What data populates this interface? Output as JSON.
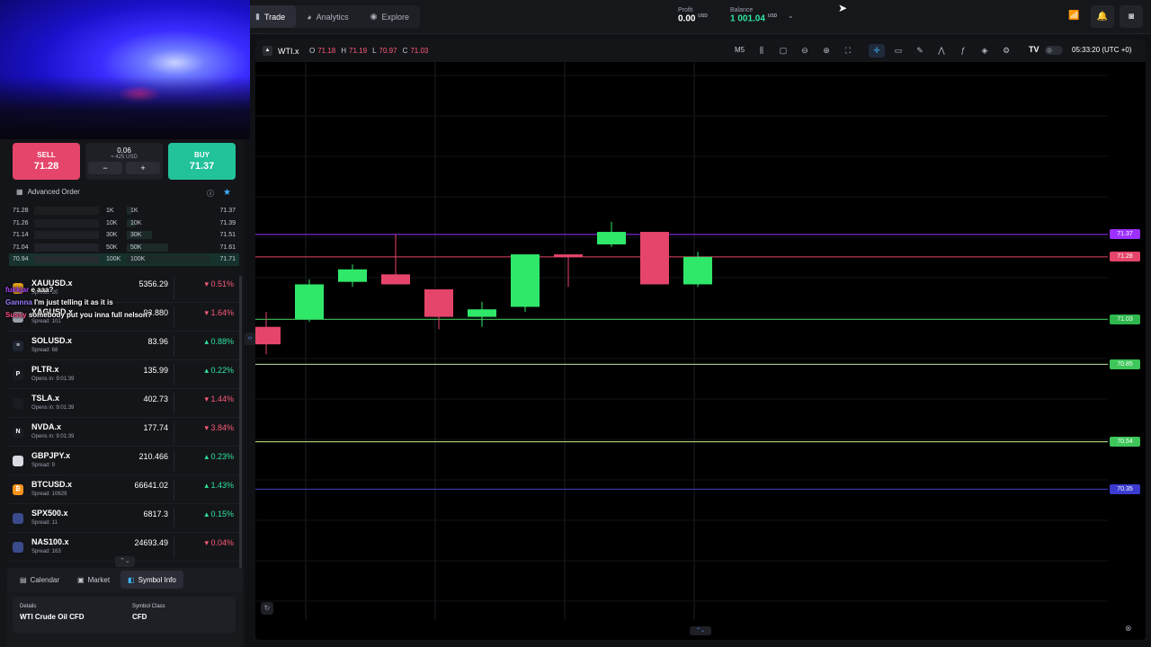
{
  "header": {
    "nav": [
      {
        "label": "Trade",
        "icon": "trade-icon"
      },
      {
        "label": "Analytics",
        "icon": "analytics-icon"
      },
      {
        "label": "Explore",
        "icon": "explore-icon"
      }
    ],
    "profit_label": "Profit",
    "profit_value": "0.00",
    "profit_unit": "USD",
    "balance_label": "Balance",
    "balance_value": "1 001.04",
    "balance_unit": "USD"
  },
  "trade": {
    "sell_label": "SELL",
    "sell_price": "71.28",
    "buy_label": "BUY",
    "buy_price": "71.37",
    "quantity": "0.06",
    "quantity_usd": "≈ 425 USD",
    "minus": "−",
    "plus": "+",
    "advanced_order": "Advanced Order"
  },
  "depth": [
    {
      "bid": "71.28",
      "bid_qty": "1K",
      "ask_qty": "1K",
      "ask": "71.37",
      "fill": 0.05
    },
    {
      "bid": "71.26",
      "bid_qty": "10K",
      "ask_qty": "10K",
      "ask": "71.39",
      "fill": 0.1
    },
    {
      "bid": "71.14",
      "bid_qty": "30K",
      "ask_qty": "30K",
      "ask": "71.51",
      "fill": 0.3
    },
    {
      "bid": "71.04",
      "bid_qty": "50K",
      "ask_qty": "50K",
      "ask": "71.61",
      "fill": 0.5
    },
    {
      "bid": "70.94",
      "bid_qty": "100K",
      "ask_qty": "100K",
      "ask": "71.71",
      "fill": 1.0
    }
  ],
  "watchlist": [
    {
      "symbol": "XAUUSD.x",
      "sub": "Spread: 20",
      "price": "5356.29",
      "change": "0.51%",
      "dir": "down",
      "icon_color": "#e2a21a",
      "icon": "gold-icon"
    },
    {
      "symbol": "XAGUSD.x",
      "sub": "Spread: 101",
      "price": "93.880",
      "change": "1.64%",
      "dir": "down",
      "icon_color": "#9aa0ab",
      "icon": "silver-icon"
    },
    {
      "symbol": "SOLUSD.x",
      "sub": "Spread: 68",
      "price": "83.96",
      "change": "0.88%",
      "dir": "up",
      "icon_color": "#1e2430",
      "icon": "solana-icon"
    },
    {
      "symbol": "PLTR.x",
      "sub": "Opens in: 9:01:39",
      "price": "135.99",
      "change": "0.22%",
      "dir": "up",
      "icon_color": "#1a1c21",
      "icon": "palantir-icon"
    },
    {
      "symbol": "TSLA.x",
      "sub": "Opens in: 9:01:39",
      "price": "402.73",
      "change": "1.44%",
      "dir": "down",
      "icon_color": "#1a1c21",
      "icon": "tesla-icon"
    },
    {
      "symbol": "NVDA.x",
      "sub": "Opens in: 9:01:39",
      "price": "177.74",
      "change": "3.84%",
      "dir": "down",
      "icon_color": "#1a1c21",
      "icon": "nvidia-icon"
    },
    {
      "symbol": "GBPJPY.x",
      "sub": "Spread: 9",
      "price": "210.466",
      "change": "0.23%",
      "dir": "up",
      "icon_color": "#d8dbe2",
      "icon": "gbp-jpy-flag-icon"
    },
    {
      "symbol": "BTCUSD.x",
      "sub": "Spread: 10629",
      "price": "66641.02",
      "change": "1.43%",
      "dir": "up",
      "icon_color": "#f7931a",
      "icon": "bitcoin-icon"
    },
    {
      "symbol": "SPX500.x",
      "sub": "Spread: 11",
      "price": "6817.3",
      "change": "0.15%",
      "dir": "up",
      "icon_color": "#3a4a8a",
      "icon": "us-flag-icon"
    },
    {
      "symbol": "NAS100.x",
      "sub": "Spread: 163",
      "price": "24693.49",
      "change": "0.04%",
      "dir": "down",
      "icon_color": "#3a4a8a",
      "icon": "us-flag-icon"
    }
  ],
  "watchlist_icon_letters": [
    "",
    "",
    "≡",
    "P",
    "",
    "N",
    "",
    "₿",
    "",
    ""
  ],
  "chat": [
    {
      "name": "fukkjar",
      "name_color": "#b043ff",
      "msg": "e aaa?"
    },
    {
      "name": "Gannna",
      "name_color": "#9b7bff",
      "msg": "I'm just telling it as it is"
    },
    {
      "name": "Sussy",
      "name_color": "#ff4f8a",
      "msg": "somebody put you inna full nelson?"
    }
  ],
  "bottom_tabs": [
    {
      "label": "Calendar",
      "icon": "calendar-icon"
    },
    {
      "label": "Market",
      "icon": "market-icon"
    },
    {
      "label": "Symbol Info",
      "icon": "symbol-info-icon"
    }
  ],
  "symbol_info": {
    "details_label": "Details",
    "details_value": "WTI Crude Oil CFD",
    "class_label": "Symbol Class",
    "class_value": "CFD"
  },
  "chart": {
    "symbol": "WTI.x",
    "open_label": "O",
    "open": "71.18",
    "high_label": "H",
    "high": "71.19",
    "low_label": "L",
    "low": "70.97",
    "close_label": "C",
    "close": "71.03",
    "timeframe": "M5",
    "time": "05:33:20 (UTC +0)"
  },
  "chart_data": {
    "type": "candlestick",
    "ylim": [
      69.83,
      72.06
    ],
    "candles": [
      {
        "o": 71.0,
        "h": 71.06,
        "l": 70.89,
        "c": 70.93
      },
      {
        "o": 71.03,
        "h": 71.19,
        "l": 71.02,
        "c": 71.17
      },
      {
        "o": 71.18,
        "h": 71.25,
        "l": 71.16,
        "c": 71.23
      },
      {
        "o": 71.21,
        "h": 71.37,
        "l": 71.17,
        "c": 71.17
      },
      {
        "o": 71.15,
        "h": 71.15,
        "l": 70.99,
        "c": 71.04
      },
      {
        "o": 71.04,
        "h": 71.1,
        "l": 71.0,
        "c": 71.07
      },
      {
        "o": 71.08,
        "h": 71.29,
        "l": 71.06,
        "c": 71.29
      },
      {
        "o": 71.29,
        "h": 71.29,
        "l": 71.16,
        "c": 71.28
      },
      {
        "o": 71.33,
        "h": 71.42,
        "l": 71.32,
        "c": 71.38
      },
      {
        "o": 71.38,
        "h": 71.38,
        "l": 71.17,
        "c": 71.17
      },
      {
        "o": 71.17,
        "h": 71.3,
        "l": 71.16,
        "c": 71.28
      }
    ],
    "price_lines": [
      {
        "price": 71.37,
        "color": "#9b30ff",
        "label": "71.37",
        "tag_bg": "#9b30ff"
      },
      {
        "price": 71.28,
        "color": "#e5456a",
        "label": "71.28",
        "tag_bg": "#e5456a"
      },
      {
        "price": 71.03,
        "color": "#3ec65a",
        "label": "71.03",
        "tag_bg": "#2fb84e"
      },
      {
        "price": 70.85,
        "color": "#bfe8a0",
        "label": "70.85",
        "tag_bg": "#3ec65a"
      },
      {
        "price": 70.54,
        "color": "#c6ef8a",
        "label": "70.54",
        "tag_bg": "#3ec65a"
      },
      {
        "price": 70.35,
        "color": "#4040c0",
        "label": "70.35",
        "tag_bg": "#3b3bd0"
      }
    ],
    "colors": {
      "up": "#2fe86a",
      "down": "#e5456a",
      "grid": "#1c1e23"
    }
  }
}
